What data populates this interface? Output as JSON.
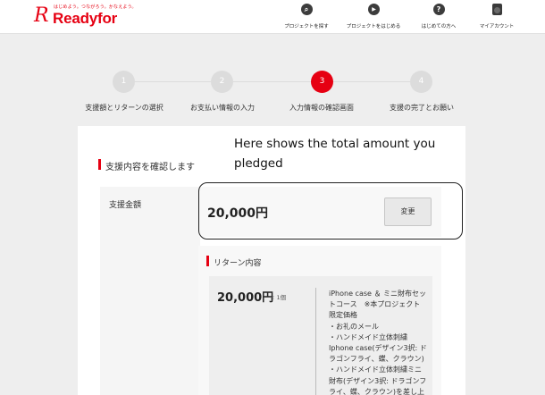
{
  "header": {
    "logo_tagline": "はじめよう。つながろう。かなえよう。",
    "logo_mark": "R",
    "logo_text": "Readyfor",
    "nav": [
      {
        "icon": "search-icon",
        "glyph": "⌕",
        "label": "プロジェクトを探す"
      },
      {
        "icon": "play-icon",
        "glyph": "▶",
        "label": "プロジェクトをはじめる"
      },
      {
        "icon": "help-icon",
        "glyph": "?",
        "label": "はじめての方へ"
      },
      {
        "icon": "account-icon",
        "glyph": "",
        "label": "マイアカウント"
      }
    ]
  },
  "steps": [
    {
      "number": "1",
      "label": "支援額とリターンの選択",
      "active": false
    },
    {
      "number": "2",
      "label": "お支払い情報の入力",
      "active": false
    },
    {
      "number": "3",
      "label": "入力情報の確認画面",
      "active": true
    },
    {
      "number": "4",
      "label": "支援の完了とお願い",
      "active": false
    }
  ],
  "confirm": {
    "section_title": "支援内容を確認します",
    "amount_label": "支援金額",
    "amount": "20,000円",
    "change_label": "変更",
    "annotation": "Here shows the total amount you pledged"
  },
  "return": {
    "title": "リターン内容",
    "amount": "20,000円",
    "quantity": "× 1個",
    "description_lines": [
      "iPhone case ＆ ミニ財布セッ",
      "トコース　※本プロジェクト",
      "限定価格",
      "・お礼のメール",
      "・ハンドメイド立体刺繍",
      "Iphone case(デザイン3択: ド",
      "ラゴンフライ、蝶、クラウン)",
      "・ハンドメイド立体刺繍ミニ",
      "財布(デザイン3択: ドラゴンフ",
      "ライ、蝶、クラウン)を差し上"
    ]
  },
  "colors": {
    "brand": "#e60012",
    "step_inactive": "#dcdcdc",
    "page_bg": "#eeeeee"
  }
}
